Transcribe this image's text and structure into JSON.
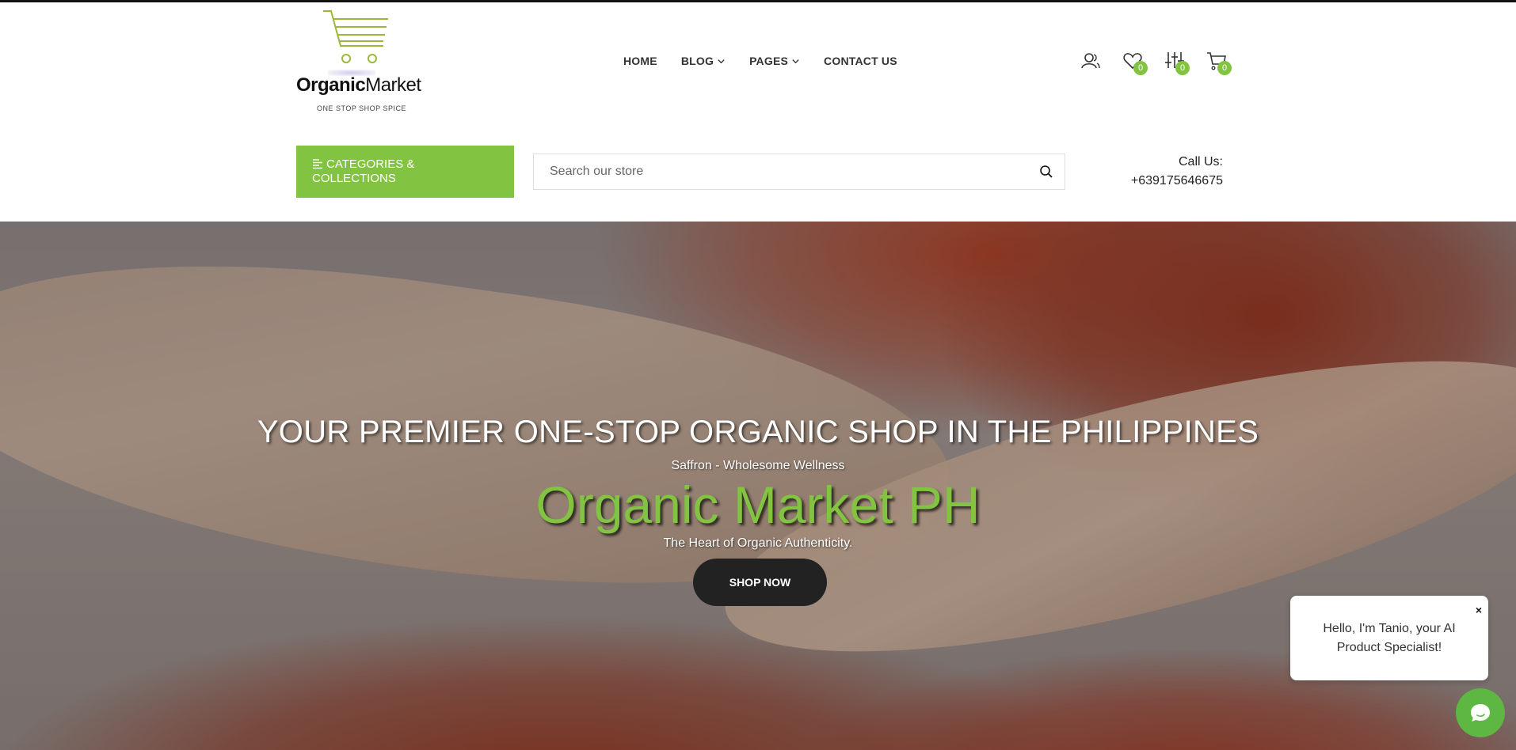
{
  "brand": {
    "name_bold": "Organic",
    "name_light": "Market",
    "tagline": "ONE STOP SHOP SPICE",
    "accent_color": "#82c341"
  },
  "nav": {
    "items": [
      {
        "label": "HOME",
        "has_dropdown": false
      },
      {
        "label": "BLOG",
        "has_dropdown": true
      },
      {
        "label": "PAGES",
        "has_dropdown": true
      },
      {
        "label": "CONTACT US",
        "has_dropdown": false
      }
    ]
  },
  "header_icons": {
    "account": {
      "icon": "user-icon"
    },
    "wishlist": {
      "icon": "heart-icon",
      "count": "0"
    },
    "compare": {
      "icon": "sliders-icon",
      "count": "0"
    },
    "cart": {
      "icon": "cart-icon",
      "count": "0"
    }
  },
  "categories_button": {
    "label": "CATEGORIES & COLLECTIONS",
    "icon": "menu-lines-icon"
  },
  "search": {
    "placeholder": "Search our store",
    "value": "",
    "icon": "search-icon"
  },
  "call": {
    "label": "Call Us:",
    "phone": "+639175646675"
  },
  "hero": {
    "title": "YOUR PREMIER ONE-STOP ORGANIC SHOP IN THE PHILIPPINES",
    "subtitle": "Saffron - Wholesome Wellness",
    "brand_line": "Organic Market PH",
    "tagline": "The Heart of Organic Authenticity.",
    "cta_label": "SHOP NOW"
  },
  "chat": {
    "message": "Hello, I'm Tanio, your AI Product Specialist!",
    "close_label": "×",
    "launcher_icon": "chat-bubble-icon",
    "launcher_color": "#5db742"
  }
}
